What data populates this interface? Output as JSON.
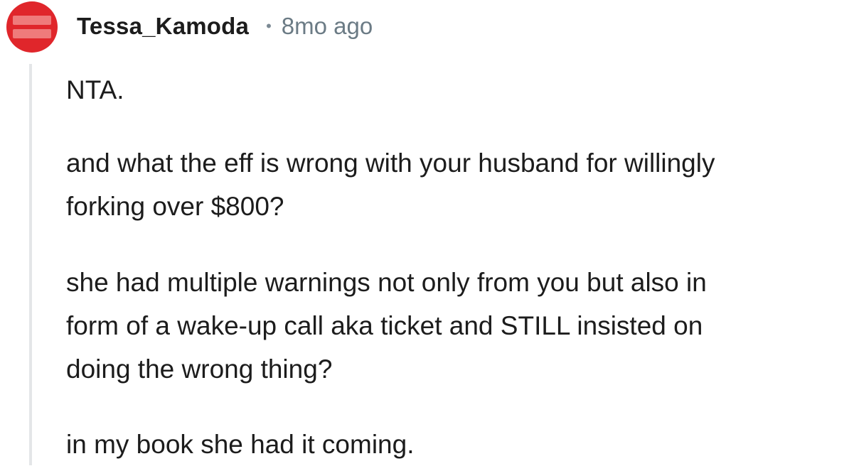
{
  "comment": {
    "username": "Tessa_Kamoda",
    "separator": "•",
    "timestamp": "8mo ago",
    "avatar_color": "#e0262b",
    "paragraphs": [
      {
        "lines": [
          "NTA."
        ]
      },
      {
        "lines": [
          "and what the eff is wrong with your husband for willingly",
          "forking over $800?"
        ]
      },
      {
        "lines": [
          "she had multiple warnings not only from you but also in",
          "form of a wake-up call aka ticket and STILL insisted on",
          "doing the wrong thing?"
        ]
      },
      {
        "lines": [
          "in my book she had it coming."
        ]
      }
    ]
  }
}
